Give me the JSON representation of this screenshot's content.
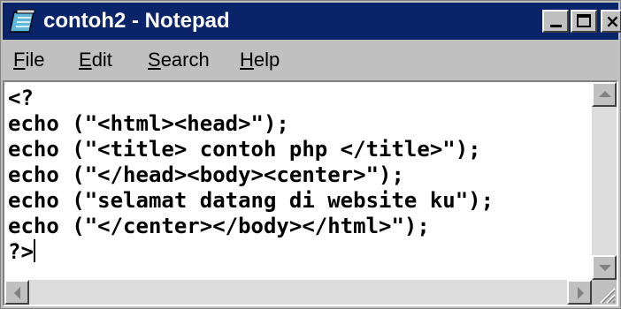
{
  "window": {
    "title": "contoh2 - Notepad",
    "title_bar_color": "#0a246a",
    "app_icon": "notepad-icon",
    "controls": {
      "minimize_icon": "minimize-icon",
      "maximize_icon": "maximize-icon",
      "close_icon": "close-icon",
      "close_glyph": "×"
    }
  },
  "menu": {
    "items": [
      {
        "accel": "F",
        "rest": "ile"
      },
      {
        "accel": "E",
        "rest": "dit"
      },
      {
        "accel": "S",
        "rest": "earch"
      },
      {
        "accel": "H",
        "rest": "elp"
      }
    ]
  },
  "editor": {
    "lines": [
      "<?",
      "echo (\"<html><head>\");",
      "echo (\"<title> contoh php </title>\");",
      "echo (\"</head><body><center>\");",
      "echo (\"selamat datang di website ku\");",
      "echo (\"</center></body></html>\");",
      "?>"
    ]
  }
}
